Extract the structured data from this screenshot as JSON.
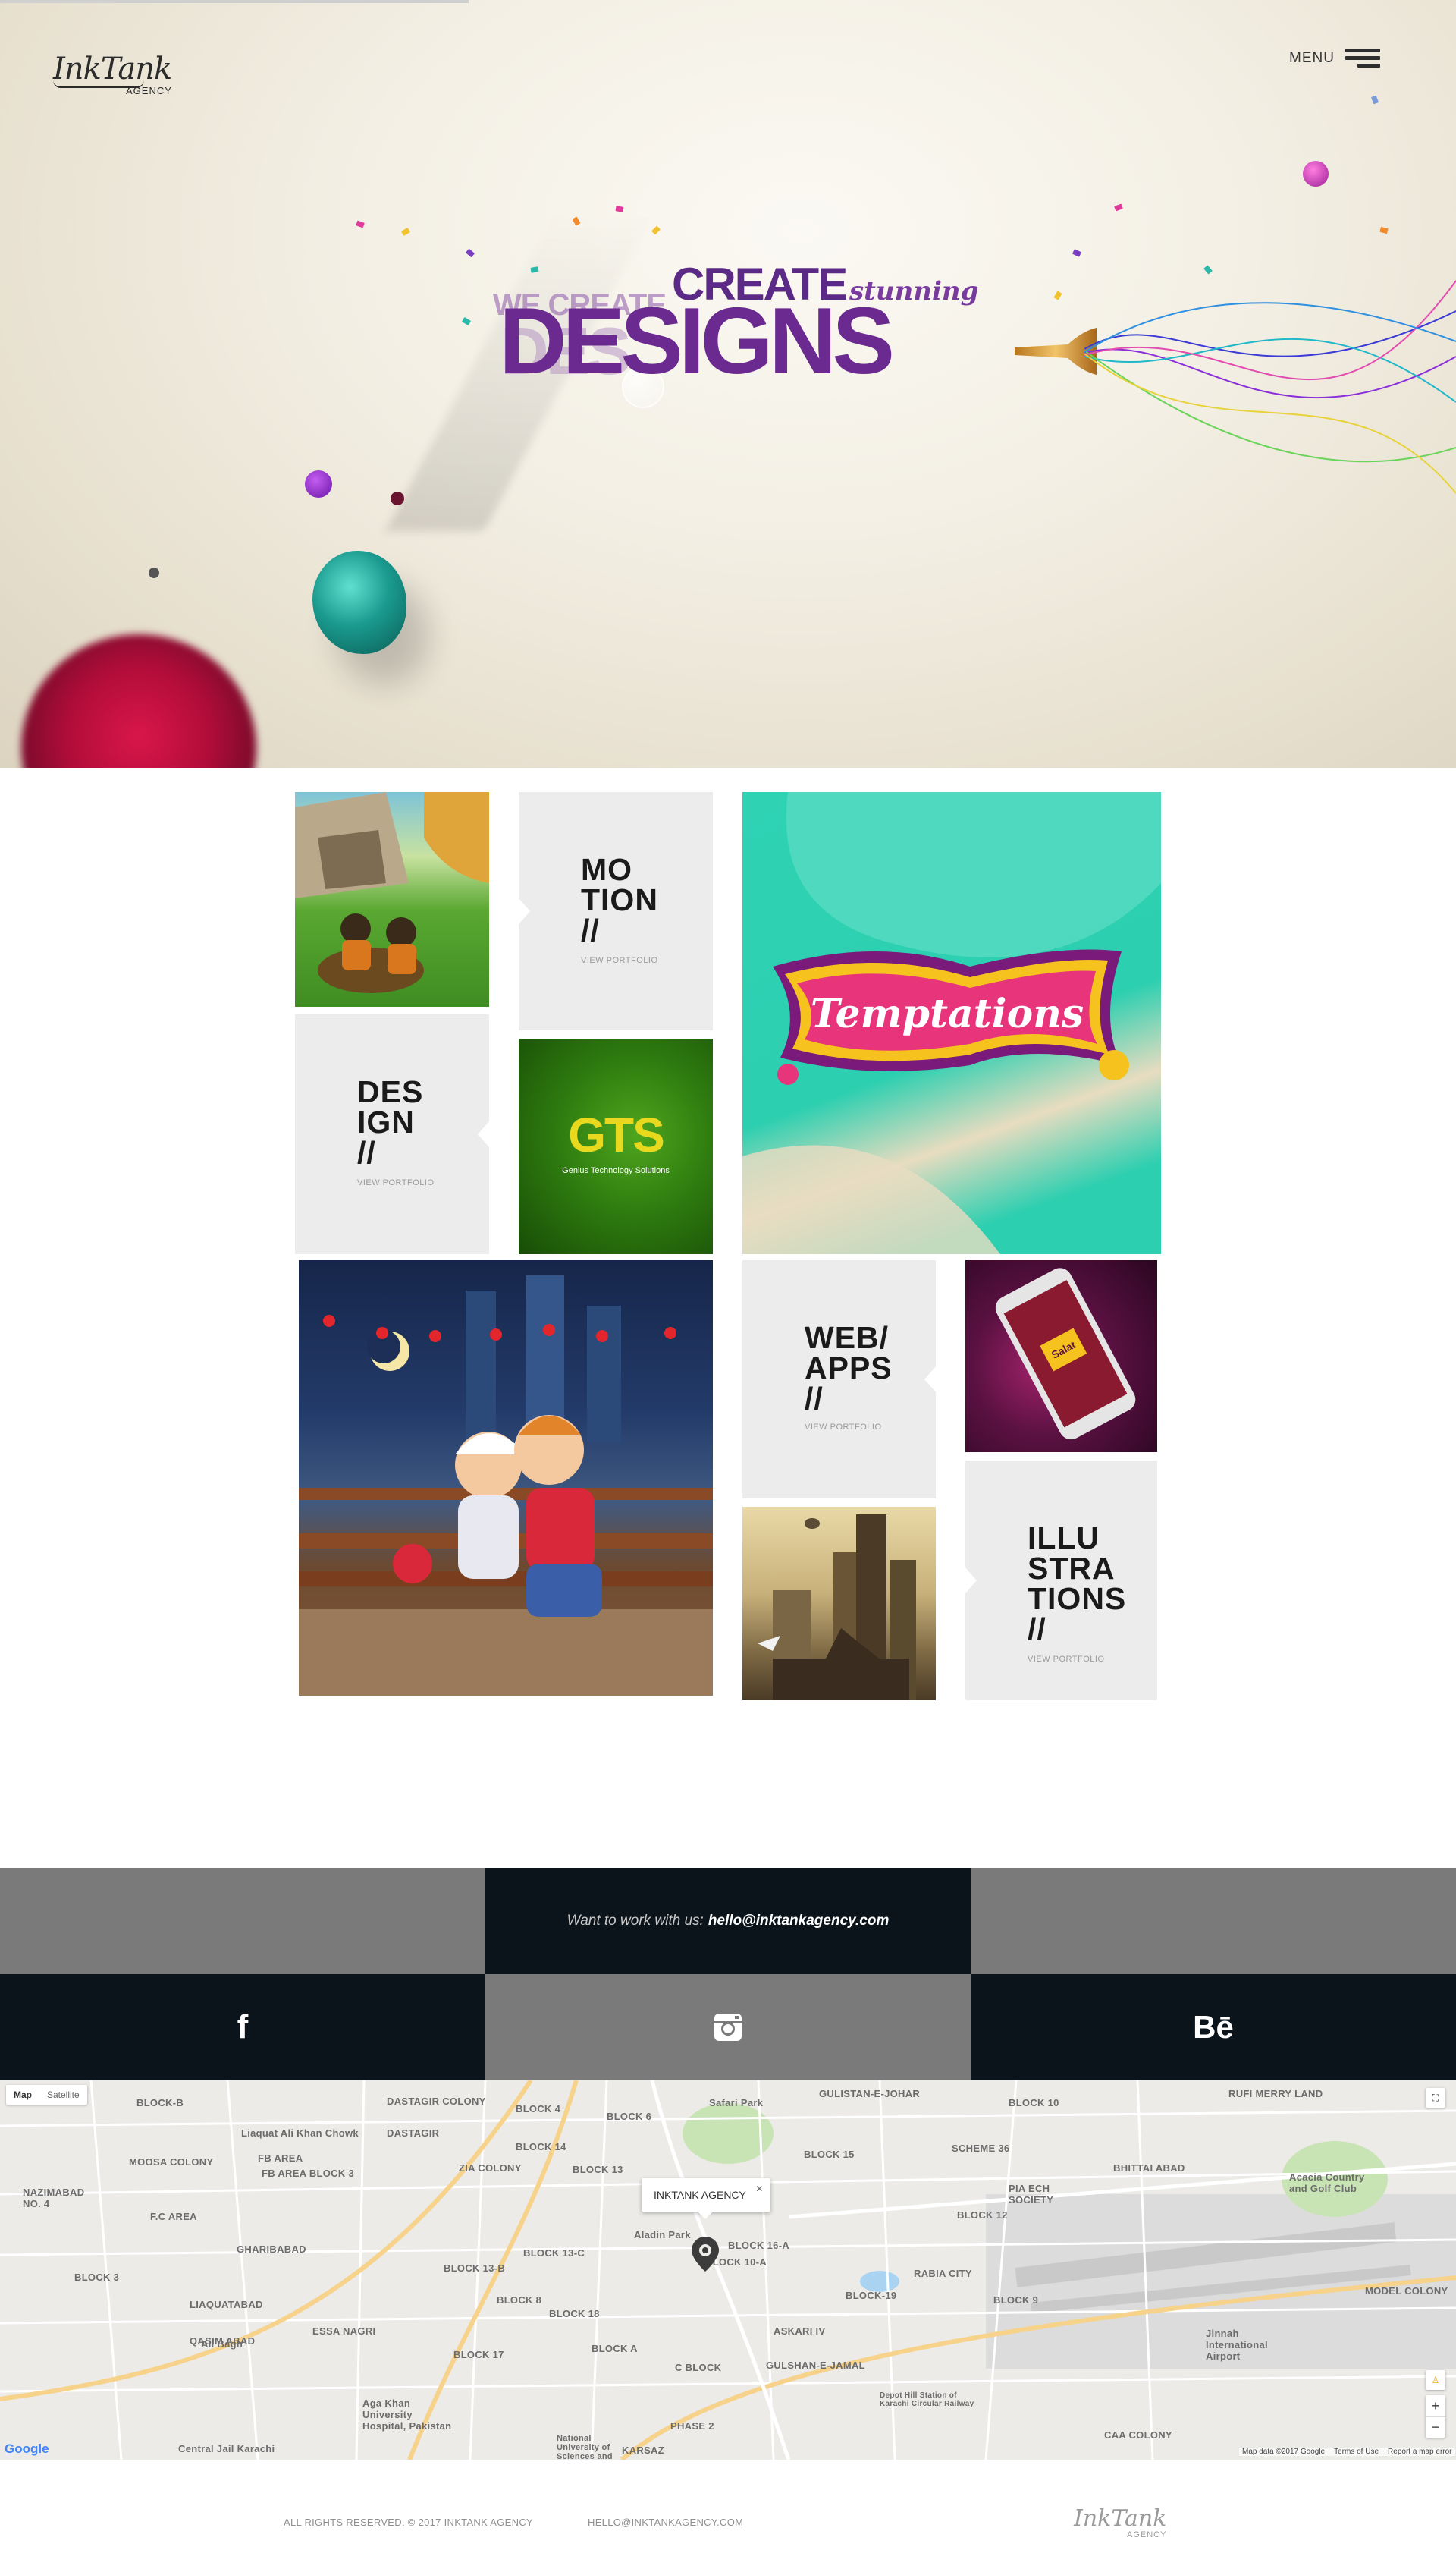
{
  "header": {
    "logo_text": "InkTank",
    "logo_sub": "AGENCY",
    "menu_label": "MENU"
  },
  "hero": {
    "headline_small": "WE CREATE",
    "headline_create": "CREATE",
    "headline_stunning": "stunning",
    "headline_ghost": "DES",
    "headline_designs": "DESIGNS"
  },
  "portfolio": {
    "motion": {
      "title": "MO\nTION\n//",
      "link": "VIEW PORTFOLIO"
    },
    "design": {
      "title": "DES\nIGN\n//",
      "link": "VIEW PORTFOLIO"
    },
    "webapps": {
      "title": "WEB/\nAPPS\n//",
      "link": "VIEW PORTFOLIO"
    },
    "illustrations": {
      "title": "ILLU\nSTRA\nTIONS\n//",
      "link": "VIEW PORTFOLIO"
    },
    "gts_logo": "GTS",
    "gts_caption": "Genius Technology Solutions",
    "temptations_text": "Temptations",
    "phone_app_label": "Salat"
  },
  "contact": {
    "prompt": "Want to work with us:",
    "email": "hello@inktankagency.com"
  },
  "social": [
    {
      "name": "facebook",
      "glyph": "f"
    },
    {
      "name": "instagram",
      "glyph": "◎"
    },
    {
      "name": "behance",
      "glyph": "Bē"
    }
  ],
  "map": {
    "type_map": "Map",
    "type_satellite": "Satellite",
    "popup_label": "INKTANK AGENCY",
    "popup_close": "×",
    "attribution": "Map data ©2017 Google",
    "terms": "Terms of Use",
    "report": "Report a map error",
    "google": "Google",
    "labels": [
      "BLOCK-B",
      "DASTAGIR COLONY",
      "BLOCK 4",
      "BLOCK 6",
      "GULISTAN-E-JOHAR",
      "BLOCK 10",
      "RUFI MERRY LAND",
      "Liaquat Ali Khan Chowk",
      "DASTAGIR",
      "FB AREA",
      "BLOCK 14",
      "Safari Park",
      "BLOCK 15",
      "SCHEME 36",
      "MOOSA COLONY",
      "FB AREA BLOCK 3",
      "ZIA COLONY",
      "BLOCK 13",
      "BHITTAI ABAD",
      "Acacia Country and Golf Club",
      "NAZIMABAD NO. 4",
      "F.C AREA",
      "BLOCK 13-C",
      "PIA ECH SOCIETY",
      "BLOCK 12",
      "GHARIBABAD",
      "Aladin Park",
      "BLOCK 10-A",
      "BLOCK 16-A",
      "RABIA CITY",
      "BLOCK 3",
      "LIAQUATABAD",
      "BLOCK 13-B",
      "BLOCK 8",
      "BLOCK-19",
      "BLOCK 9",
      "BLOCK 18",
      "MODEL COLONY",
      "QASIM ABAD",
      "ESSA NAGRI",
      "ASKARI IV",
      "Jinnah International Airport",
      "BLOCK A",
      "C BLOCK",
      "GULSHAN-E-JAMAL",
      "BLOCK 17",
      "Aga Khan University Hospital, Pakistan",
      "PHASE 2",
      "CAA COLONY",
      "Central Jail Karachi",
      "National University of Sciences and",
      "KARSAZ",
      "Ali Bagh",
      "Depot Hill Station of Karachi Circular Railway"
    ]
  },
  "footer": {
    "copyright": "ALL RIGHTS RESERVED. © 2017 INKTANK AGENCY",
    "email": "HELLO@INKTANKAGENCY.COM",
    "logo_text": "InkTank",
    "logo_sub": "AGENCY"
  }
}
